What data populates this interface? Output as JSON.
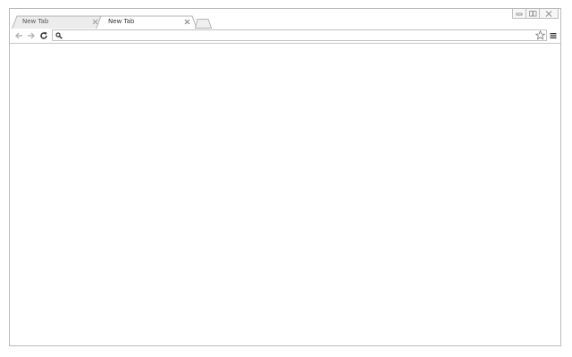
{
  "browser": {
    "tabs": [
      {
        "title": "New Tab",
        "active": false,
        "close_icon": "close-icon"
      },
      {
        "title": "New Tab",
        "active": true,
        "close_icon": "close-icon"
      }
    ],
    "new_tab_icon": "new-tab-icon",
    "window_controls": [
      "minimize-icon",
      "restore-icon",
      "close-icon"
    ],
    "toolbar": {
      "back_icon": "back-arrow-icon",
      "forward_icon": "forward-arrow-icon",
      "reload_icon": "reload-icon",
      "search_icon": "search-icon",
      "address_value": "",
      "bookmark_icon": "star-icon",
      "menu_icon": "menu-icon"
    }
  }
}
